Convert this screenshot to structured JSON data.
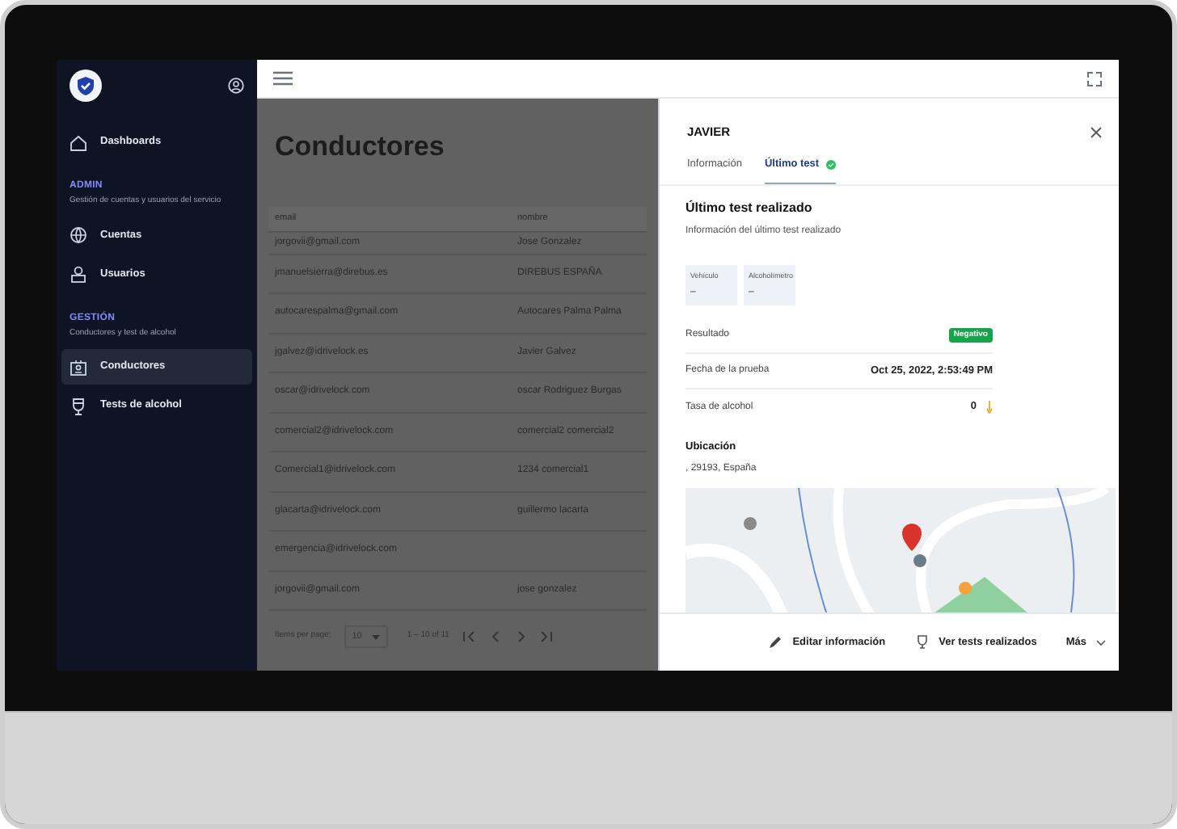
{
  "sidebar": {
    "sections": [
      {
        "items": [
          {
            "label": "Dashboards",
            "selected": false
          }
        ]
      },
      {
        "title": "ADMIN",
        "subtitle": "Gestión de cuentas y usuarios del servicio",
        "items": [
          {
            "label": "Cuentas",
            "selected": false
          },
          {
            "label": "Usuarios",
            "selected": false
          }
        ]
      },
      {
        "title": "GESTIÓN",
        "subtitle": "Conductores y test de alcohol",
        "items": [
          {
            "label": "Conductores",
            "selected": true
          },
          {
            "label": "Tests de alcohol",
            "selected": false
          }
        ]
      }
    ]
  },
  "main": {
    "title": "Conductores",
    "table": {
      "columns": [
        "email",
        "nombre"
      ],
      "rows": [
        [
          "jorgovii@gmail.com",
          "Jose Gonzalez"
        ],
        [
          "jmanuelsierra@direbus.es",
          "DIREBUS ESPAÑA"
        ],
        [
          "autocarespalma@gmail.com",
          "Autocares Palma Palma"
        ],
        [
          "jgalvez@idrivelock.es",
          "Javier Galvez"
        ],
        [
          "oscar@idrivelock.com",
          "oscar Rodriguez Burgas"
        ],
        [
          "comercial2@idrivelock.com",
          "comercial2 comercial2"
        ],
        [
          "Comercial1@idrivelock.com",
          "1234 comercial1"
        ],
        [
          "glacarta@idrivelock.com",
          "guillermo lacarta"
        ],
        [
          "emergencia@idrivelock.com",
          ""
        ],
        [
          "jorgovii@gmail.com",
          "jose gonzalez"
        ]
      ]
    },
    "pagination": {
      "label": "Items per page:",
      "page_size": "10",
      "range": "1 – 10 of 11"
    }
  },
  "drawer": {
    "title": "JAVIER",
    "tabs": [
      {
        "label": "Información",
        "selected": false
      },
      {
        "label": "Último test",
        "selected": true
      }
    ],
    "section_title": "Último test realizado",
    "section_subtitle": "Información del último test realizado",
    "cards": [
      {
        "label": "Vehículo",
        "value": "–"
      },
      {
        "label": "Alcoholímetro",
        "value": "–"
      }
    ],
    "details": [
      {
        "label": "Resultado",
        "kind": "badge",
        "value": "Negativo"
      },
      {
        "label": "Fecha de la prueba",
        "kind": "text",
        "value": "Oct 25, 2022, 2:53:49 PM"
      },
      {
        "label": "Tasa de alcohol",
        "kind": "arrow",
        "value": "0"
      }
    ],
    "location": {
      "title": "Ubicación",
      "address": ", 29193, España"
    },
    "actions": [
      "Editar información",
      "Ver tests realizados",
      "Más"
    ]
  }
}
